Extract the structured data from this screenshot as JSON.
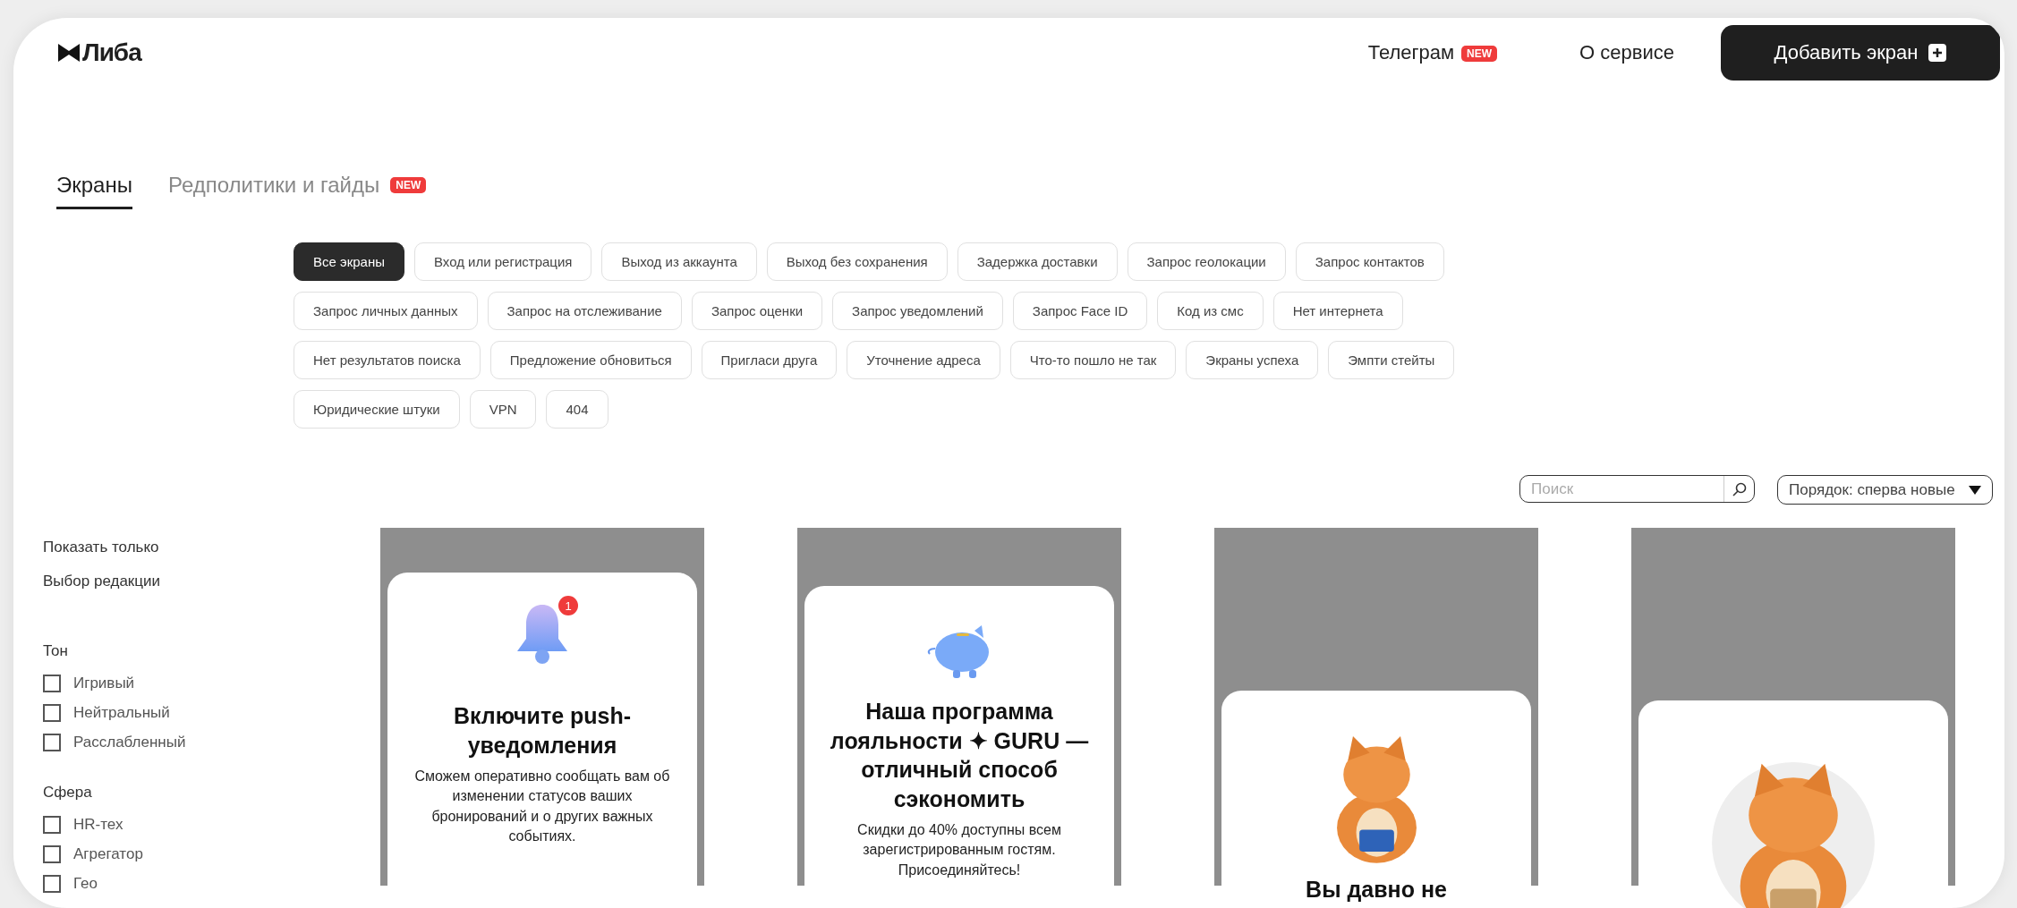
{
  "header": {
    "logo": "Либа",
    "nav": [
      {
        "label": "Телеграм",
        "badge": "NEW"
      },
      {
        "label": "О сервисе"
      }
    ],
    "add_button": {
      "label": "Добавить экран"
    }
  },
  "tabs": [
    {
      "label": "Экраны",
      "selected": true
    },
    {
      "label": "Редполитики и гайды",
      "selected": false,
      "badge": "NEW"
    }
  ],
  "chips": [
    {
      "label": "Все экраны",
      "selected": true
    },
    {
      "label": "Вход или регистрация",
      "selected": false
    },
    {
      "label": "Выход из аккаунта",
      "selected": false
    },
    {
      "label": "Выход без сохранения",
      "selected": false
    },
    {
      "label": "Задержка доставки",
      "selected": false
    },
    {
      "label": "Запрос геолокации",
      "selected": false
    },
    {
      "label": "Запрос контактов",
      "selected": false
    },
    {
      "label": "Запрос личных данных",
      "selected": false
    },
    {
      "label": "Запрос на отслеживание",
      "selected": false
    },
    {
      "label": "Запрос оценки",
      "selected": false
    },
    {
      "label": "Запрос уведомлений",
      "selected": false
    },
    {
      "label": "Запрос Face ID",
      "selected": false
    },
    {
      "label": "Код из смс",
      "selected": false
    },
    {
      "label": "Нет интернета",
      "selected": false
    },
    {
      "label": "Нет результатов поиска",
      "selected": false
    },
    {
      "label": "Предложение обновиться",
      "selected": false
    },
    {
      "label": "Пригласи друга",
      "selected": false
    },
    {
      "label": "Уточнение адреса",
      "selected": false
    },
    {
      "label": "Что-то пошло не так",
      "selected": false
    },
    {
      "label": "Экраны успеха",
      "selected": false
    },
    {
      "label": "Эмпти стейты",
      "selected": false
    },
    {
      "label": "Юридические штуки",
      "selected": false
    },
    {
      "label": "VPN",
      "selected": false
    },
    {
      "label": "404",
      "selected": false
    }
  ],
  "search": {
    "placeholder": "Поиск"
  },
  "sort": {
    "value": "Порядок: сперва новые"
  },
  "sidebar": {
    "show_only": {
      "title": "Показать только",
      "items": [
        {
          "label": "Выбор редакции"
        }
      ]
    },
    "groups": [
      {
        "title": "Тон",
        "options": [
          {
            "label": "Игривый",
            "checked": false
          },
          {
            "label": "Нейтральный",
            "checked": false
          },
          {
            "label": "Расслабленный",
            "checked": false
          }
        ]
      },
      {
        "title": "Сфера",
        "options": [
          {
            "label": "HR-тех",
            "checked": false
          },
          {
            "label": "Агрегатор",
            "checked": false
          },
          {
            "label": "Гео",
            "checked": false
          }
        ]
      }
    ]
  },
  "cards": [
    {
      "kind": "bell",
      "badge": "1",
      "title": "Включите push-уведомления",
      "text": "Сможем оперативно сообщать вам об изменении статусов ваших бронирований и о других важных событиях."
    },
    {
      "kind": "piggy",
      "title": "Наша программа лояльности ✦ GURU — отличный способ сэкономить",
      "text": "Скидки до 40% доступны всем зарегистрированным гостям. Присоединяйтесь!"
    },
    {
      "kind": "picture",
      "title": "Вы давно не"
    },
    {
      "kind": "picture"
    }
  ]
}
